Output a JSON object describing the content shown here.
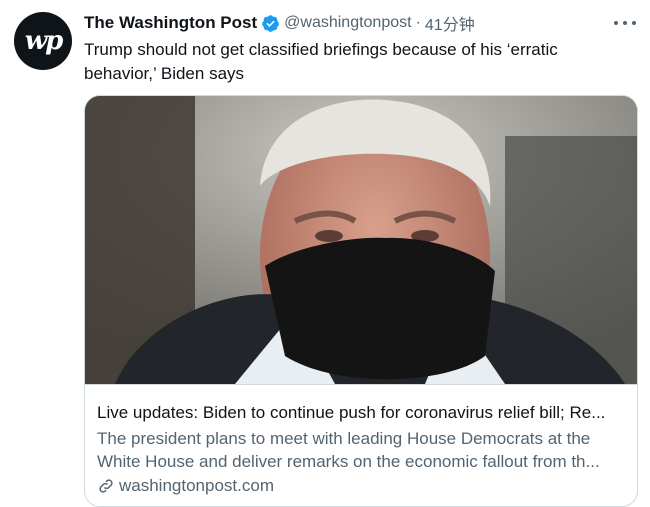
{
  "tweet": {
    "author_name": "The Washington Post",
    "handle": "@washingtonpost",
    "separator": "·",
    "time": "41分钟",
    "text": "Trump should not get classified briefings because of his ‘erratic behavior,’ Biden says",
    "avatar_icon": "washington-post-logo",
    "more_icon": "more-horizontal-icon",
    "verified_icon": "verified-badge-icon"
  },
  "card": {
    "title": "Live updates: Biden to continue push for coronavirus relief bill; Re...",
    "description": "The president plans to meet with leading House Democrats at the White House and deliver remarks on the economic fallout from th...",
    "domain": "washingtonpost.com",
    "link_icon": "link-icon",
    "image_alt": "photo of man wearing black face mask"
  },
  "colors": {
    "text_primary": "#0f1419",
    "text_secondary": "#536471",
    "verified": "#1d9bf0",
    "border": "#cfd9de"
  }
}
